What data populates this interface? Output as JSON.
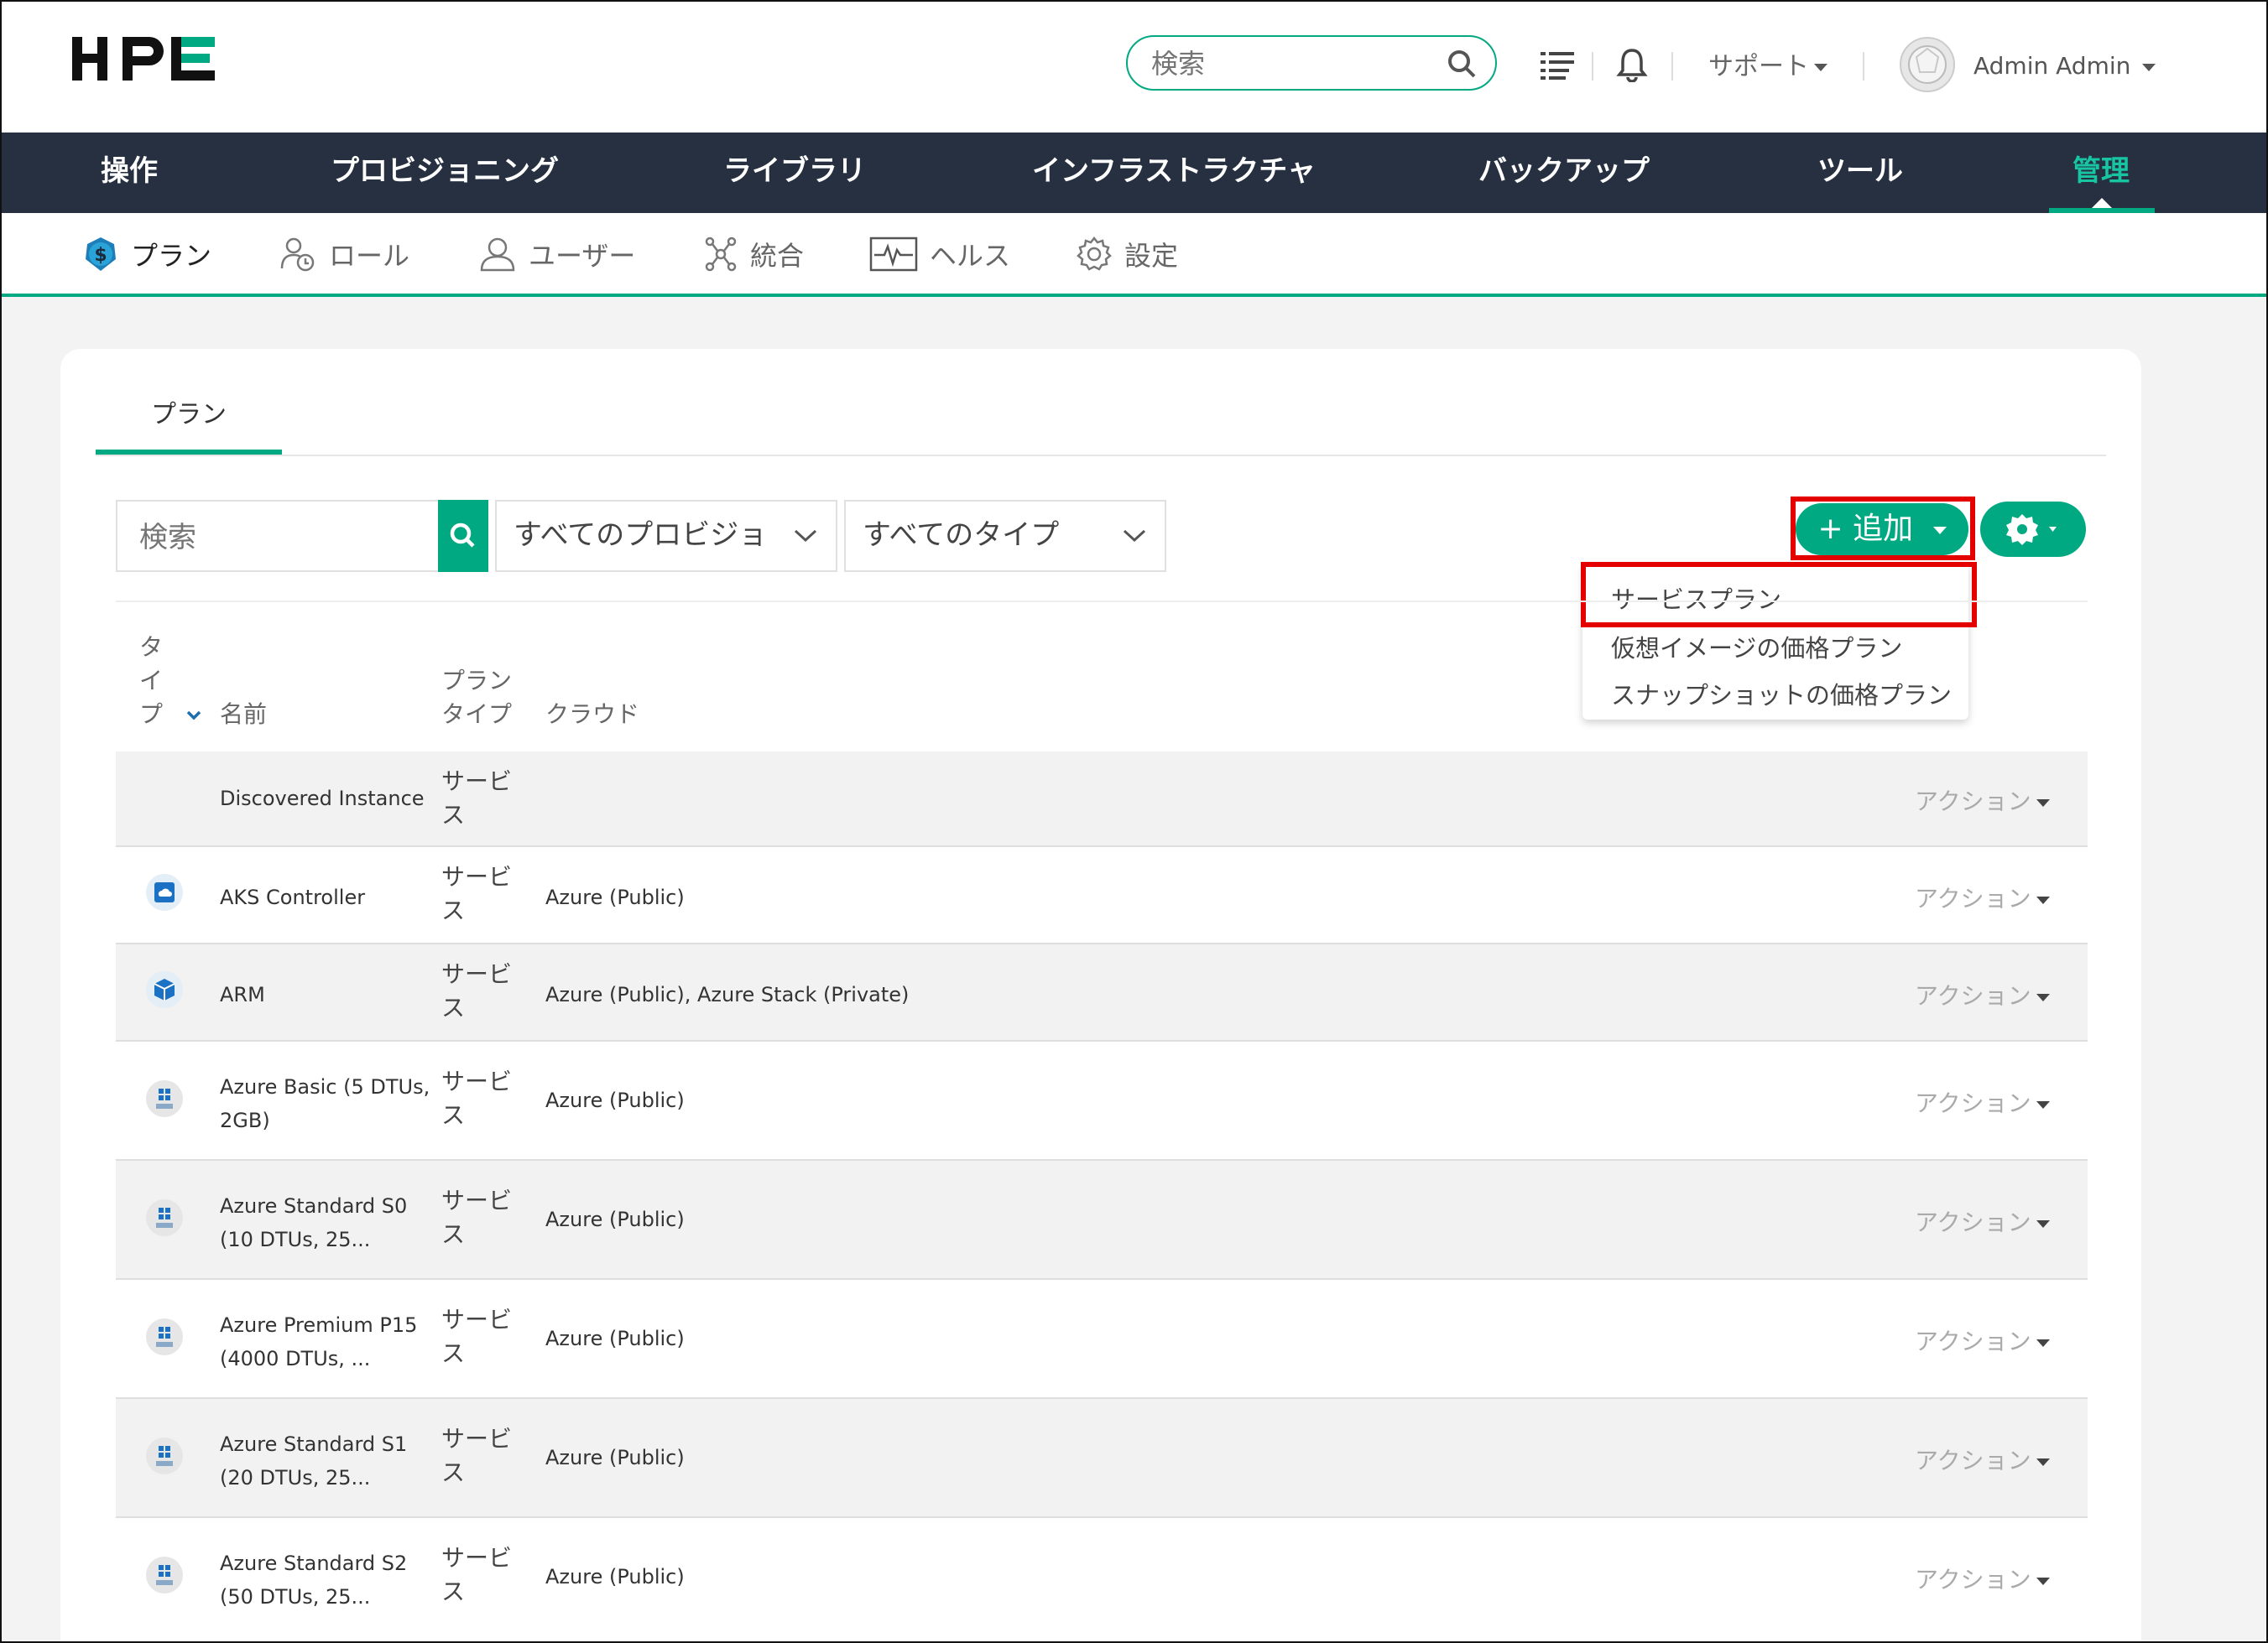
{
  "header": {
    "logo": "HPE",
    "search_placeholder": "検索",
    "support": "サポート",
    "user": "Admin Admin"
  },
  "nav": {
    "items": [
      "操作",
      "プロビジョニング",
      "ライブラリ",
      "インフラストラクチャ",
      "バックアップ",
      "ツール",
      "管理"
    ],
    "active": "管理"
  },
  "subnav": {
    "items": [
      "プラン",
      "ロール",
      "ユーザー",
      "統合",
      "ヘルス",
      "設定"
    ],
    "active": "プラン"
  },
  "page": {
    "tab": "プラン",
    "search_placeholder": "検索",
    "provisioning_filter": "すべてのプロビジョ",
    "type_filter": "すべてのタイプ",
    "add_button": "+ 追加",
    "add_menu": [
      "サービスプラン",
      "仮想イメージの価格プラン",
      "スナップショットの価格プラン"
    ]
  },
  "table": {
    "headers": {
      "type": [
        "タ",
        "イ",
        "プ"
      ],
      "name": "名前",
      "plan_type": [
        "プラン",
        "タイプ"
      ],
      "cloud": "クラウド"
    },
    "rows": [
      {
        "name": [
          "Discovered Instance"
        ],
        "plan_type": [
          "サービ",
          "ス"
        ],
        "cloud": "",
        "action": "アクション",
        "icon": "none"
      },
      {
        "name": [
          "AKS Controller"
        ],
        "plan_type": [
          "サービ",
          "ス"
        ],
        "cloud": "Azure (Public)",
        "action": "アクション",
        "icon": "aks-icon"
      },
      {
        "name": [
          "ARM"
        ],
        "plan_type": [
          "サービ",
          "ス"
        ],
        "cloud": "Azure (Public), Azure Stack (Private)",
        "action": "アクション",
        "icon": "arm-cube-icon"
      },
      {
        "name": [
          "Azure Basic (5 DTUs,",
          "2GB)"
        ],
        "plan_type": [
          "サービ",
          "ス"
        ],
        "cloud": "Azure (Public)",
        "action": "アクション",
        "icon": "sql-server-icon"
      },
      {
        "name": [
          "Azure Standard S0",
          "(10 DTUs, 25..."
        ],
        "plan_type": [
          "サービ",
          "ス"
        ],
        "cloud": "Azure (Public)",
        "action": "アクション",
        "icon": "sql-server-icon"
      },
      {
        "name": [
          "Azure Premium P15",
          "(4000 DTUs, ..."
        ],
        "plan_type": [
          "サービ",
          "ス"
        ],
        "cloud": "Azure (Public)",
        "action": "アクション",
        "icon": "sql-server-icon"
      },
      {
        "name": [
          "Azure Standard S1",
          "(20 DTUs, 25..."
        ],
        "plan_type": [
          "サービ",
          "ス"
        ],
        "cloud": "Azure (Public)",
        "action": "アクション",
        "icon": "sql-server-icon"
      },
      {
        "name": [
          "Azure Standard S2",
          "(50 DTUs, 25..."
        ],
        "plan_type": [
          "サービ",
          "ス"
        ],
        "cloud": "Azure (Public)",
        "action": "アクション",
        "icon": "sql-server-icon"
      }
    ]
  },
  "colors": {
    "accent": "#01a982",
    "nav_bg": "#263040",
    "highlight": "#e50000"
  }
}
